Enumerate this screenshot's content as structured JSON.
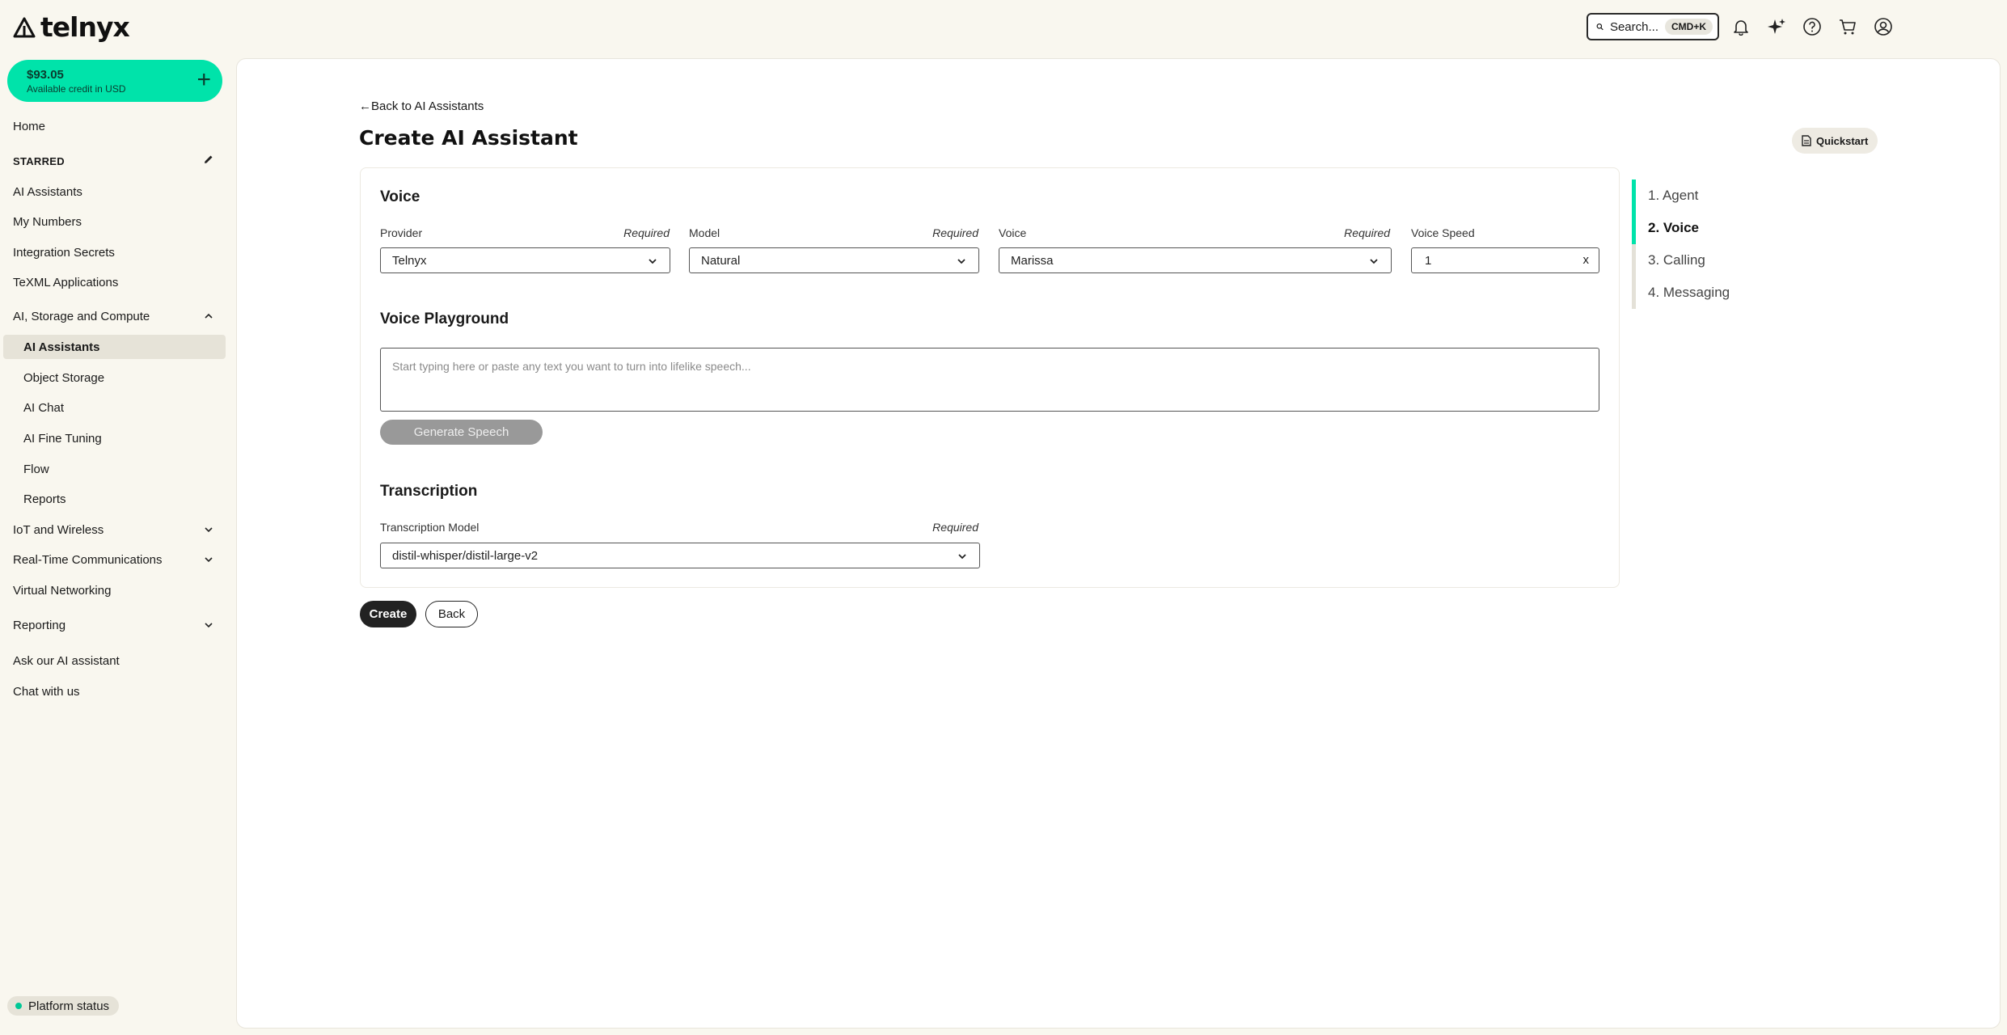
{
  "brand": {
    "name": "telnyx"
  },
  "topbar": {
    "search_label": "Search...",
    "search_shortcut": "CMD+K",
    "icons": [
      "bell-icon",
      "sparkle-icon",
      "help-icon",
      "cart-icon",
      "user-icon"
    ]
  },
  "credit": {
    "amount": "$93.05",
    "label": "Available credit in USD"
  },
  "sidebar": {
    "home": "Home",
    "starred_label": "STARRED",
    "starred_items": [
      "AI Assistants",
      "My Numbers",
      "Integration Secrets",
      "TeXML Applications"
    ],
    "group_ai": "AI, Storage and Compute",
    "ai_items": [
      "AI Assistants",
      "Object Storage",
      "AI Chat",
      "AI Fine Tuning",
      "Flow",
      "Reports"
    ],
    "iot": "IoT and Wireless",
    "rtc": "Real-Time Communications",
    "vnet": "Virtual Networking",
    "reporting": "Reporting",
    "ask_ai": "Ask our AI assistant",
    "chat": "Chat with us",
    "platform_status": "Platform status"
  },
  "page": {
    "back_link": "Back to AI Assistants",
    "title": "Create AI Assistant",
    "quickstart": "Quickstart"
  },
  "voice": {
    "title": "Voice",
    "provider_label": "Provider",
    "provider_value": "Telnyx",
    "model_label": "Model",
    "model_value": "Natural",
    "voice_label": "Voice",
    "voice_value": "Marissa",
    "speed_label": "Voice Speed",
    "speed_value": "1",
    "speed_clear": "x",
    "required": "Required"
  },
  "playground": {
    "title": "Voice Playground",
    "placeholder": "Start typing here or paste any text you want to turn into lifelike speech...",
    "generate": "Generate Speech"
  },
  "transcription": {
    "title": "Transcription",
    "model_label": "Transcription Model",
    "model_value": "distil-whisper/distil-large-v2",
    "required": "Required"
  },
  "actions": {
    "create": "Create",
    "back": "Back"
  },
  "steps": [
    "1. Agent",
    "2. Voice",
    "3. Calling",
    "4. Messaging"
  ],
  "accent_color": "#00e3aa"
}
